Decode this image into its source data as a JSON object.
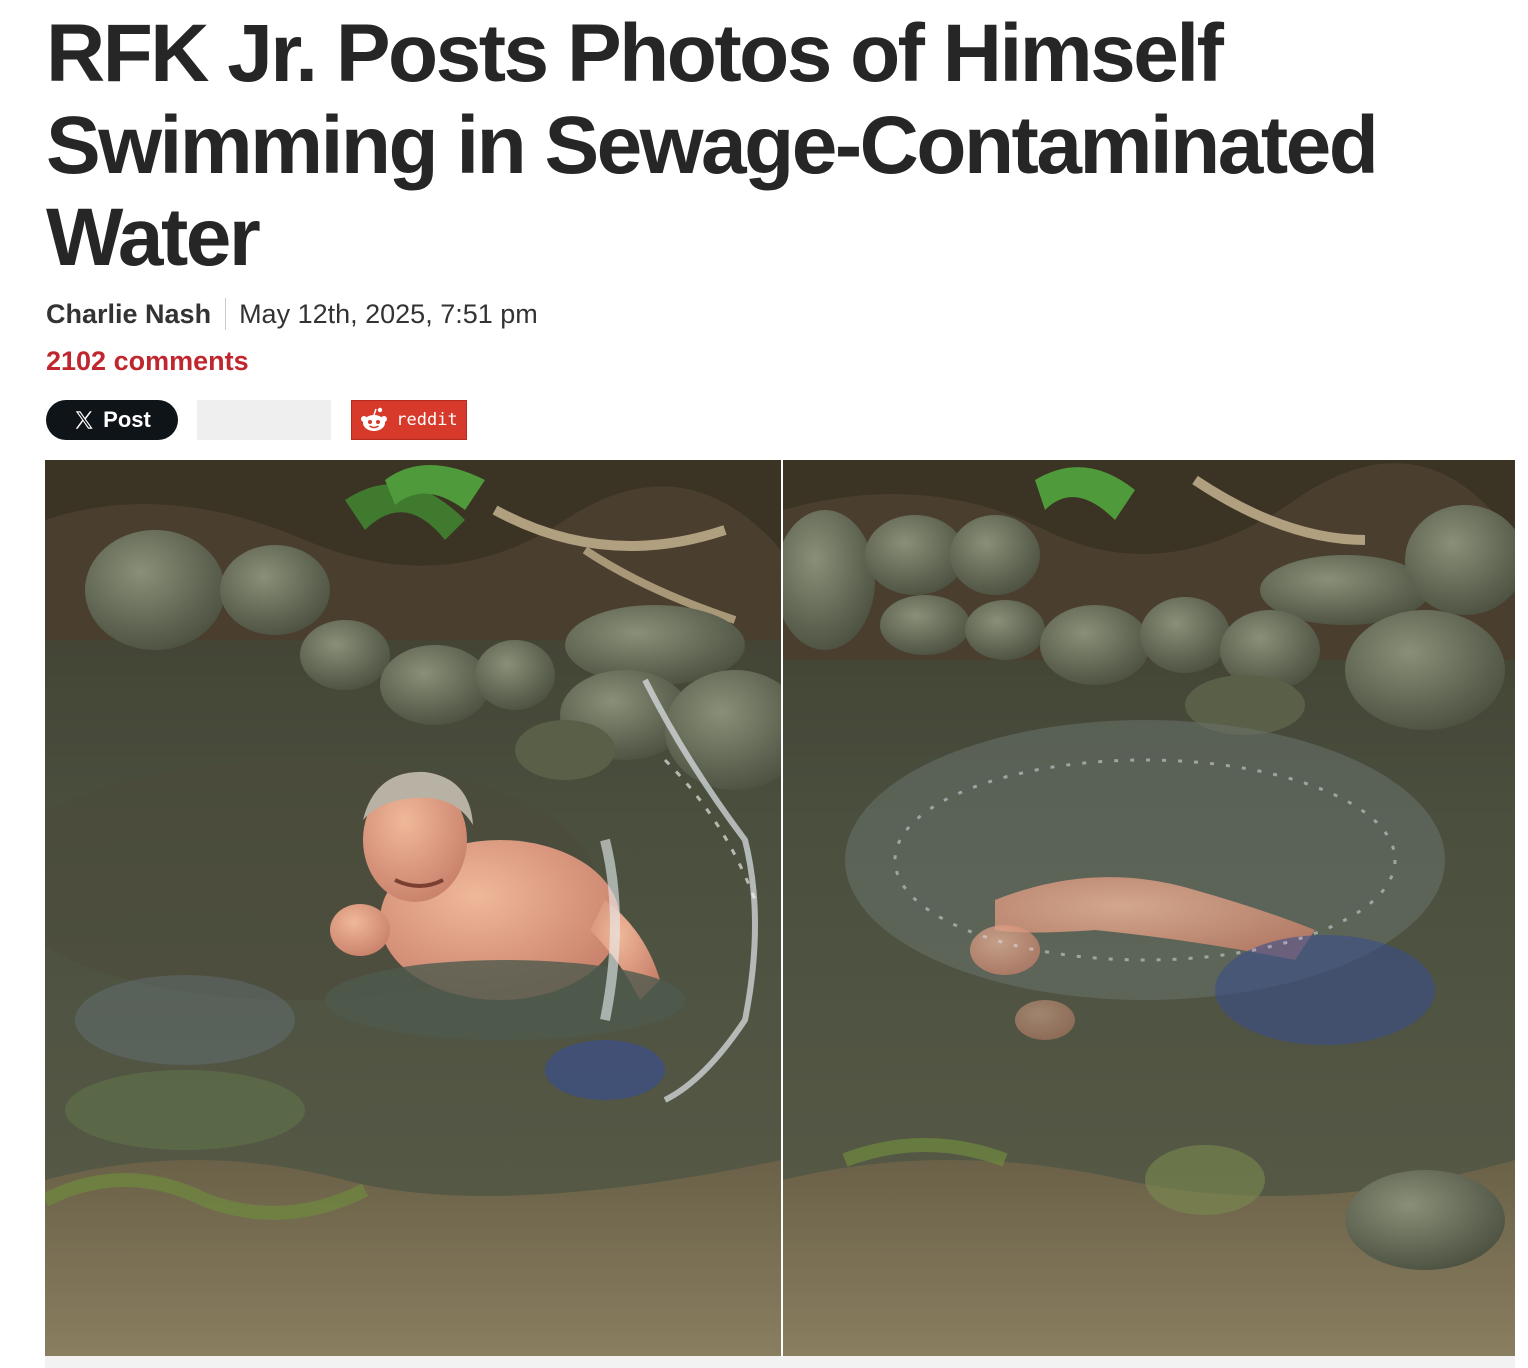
{
  "article": {
    "headline": "RFK Jr. Posts Photos of Himself Swimming in Sewage-Contaminated Water",
    "author": "Charlie Nash",
    "date": "May 12th, 2025, 7:51 pm",
    "comments": "2102 comments"
  },
  "share": {
    "x_label": "Post",
    "x_icon": "x-logo-icon",
    "reddit_label": "reddit",
    "reddit_icon": "reddit-alien-icon"
  },
  "photo": {
    "panels": [
      "man-splashing-in-creek",
      "man-submerged-swimming-in-creek"
    ]
  },
  "colors": {
    "headline": "#262626",
    "comments_link": "#c0262e",
    "x_button": "#0f1419",
    "reddit_button": "#d73a2a"
  }
}
